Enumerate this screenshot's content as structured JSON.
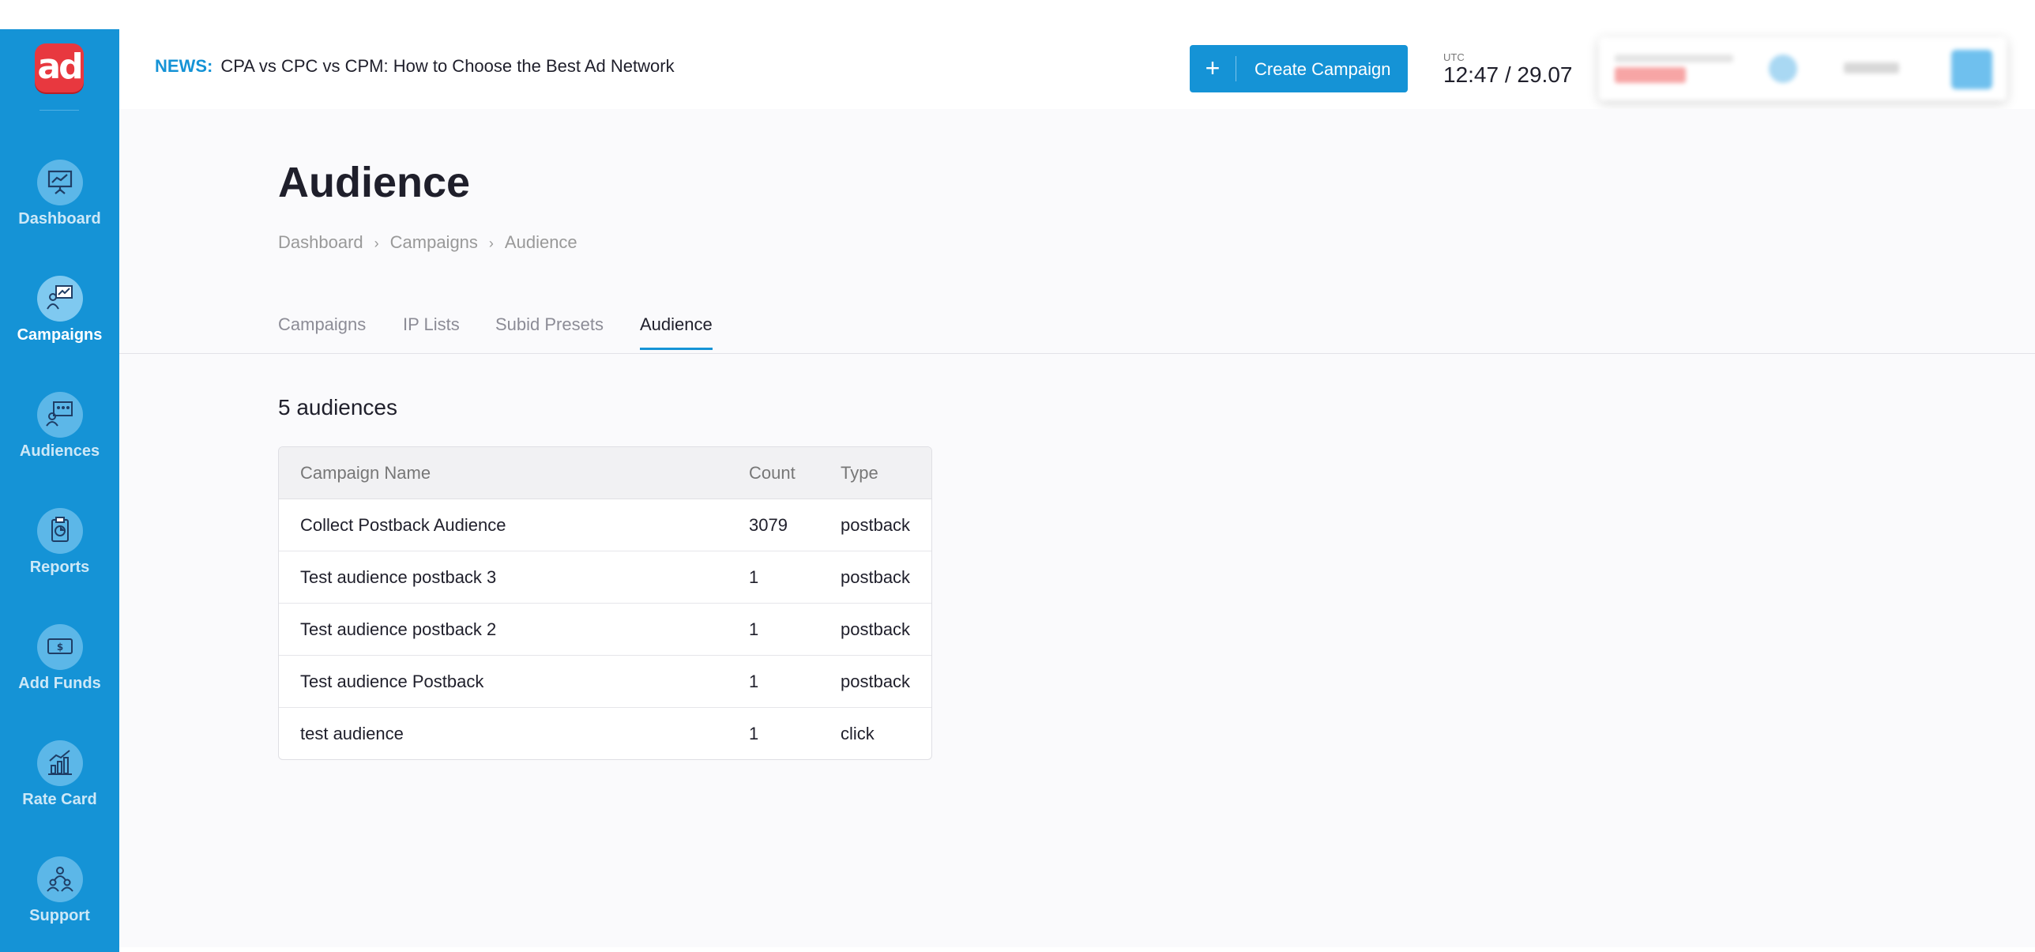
{
  "sidebar": {
    "logo": "ad",
    "items": [
      {
        "label": "Dashboard",
        "icon": "presentation-chart-icon"
      },
      {
        "label": "Campaigns",
        "icon": "campaign-person-icon"
      },
      {
        "label": "Audiences",
        "icon": "audience-screen-icon"
      },
      {
        "label": "Reports",
        "icon": "clipboard-report-icon"
      },
      {
        "label": "Add Funds",
        "icon": "money-bill-icon"
      },
      {
        "label": "Rate Card",
        "icon": "bar-chart-icon"
      },
      {
        "label": "Support",
        "icon": "support-people-icon"
      }
    ],
    "active_index": 1
  },
  "header": {
    "news_tag": "NEWS:",
    "news_text": "CPA vs CPC vs CPM: How to Choose the Best Ad Network",
    "create_button": "Create Campaign",
    "utc_label": "UTC",
    "utc_time": "12:47 / 29.07"
  },
  "page": {
    "title": "Audience",
    "breadcrumb": [
      "Dashboard",
      "Campaigns",
      "Audience"
    ],
    "tabs": [
      "Campaigns",
      "IP Lists",
      "Subid Presets",
      "Audience"
    ],
    "active_tab": 3,
    "count_heading": "5 audiences"
  },
  "table": {
    "headers": [
      "Campaign Name",
      "Count",
      "Type"
    ],
    "rows": [
      [
        "Collect Postback Audience",
        "3079",
        "postback"
      ],
      [
        "Test audience postback 3",
        "1",
        "postback"
      ],
      [
        "Test audience postback 2",
        "1",
        "postback"
      ],
      [
        "Test audience Postback",
        "1",
        "postback"
      ],
      [
        "test audience",
        "1",
        "click"
      ]
    ]
  },
  "colors": {
    "accent": "#1593d6",
    "logo": "#e8383f"
  }
}
